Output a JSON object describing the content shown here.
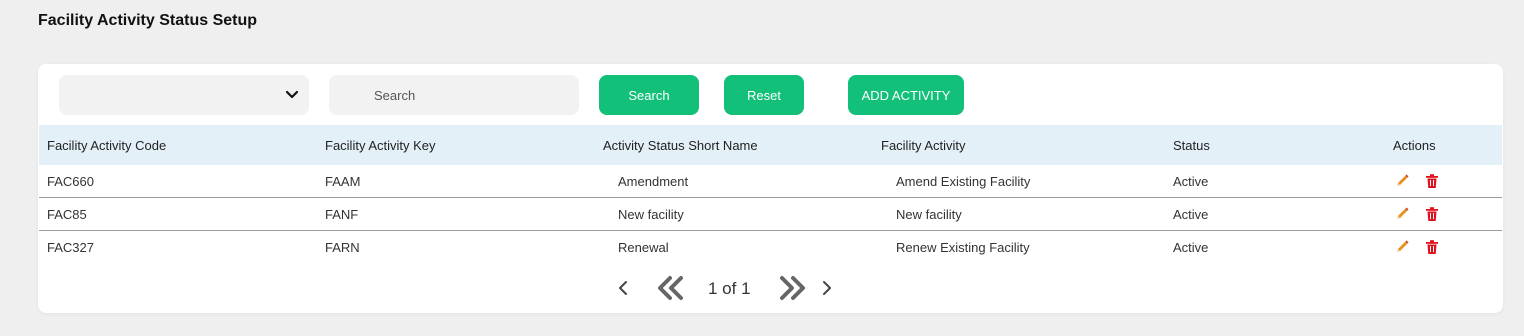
{
  "page": {
    "title": "Facility Activity Status Setup"
  },
  "filters": {
    "select_value": "",
    "search_placeholder": "Search",
    "search_button": "Search",
    "reset_button": "Reset",
    "add_button": "ADD ACTIVITY"
  },
  "table": {
    "headers": [
      "Facility Activity Code",
      "Facility Activity Key",
      "Activity Status Short Name",
      "Facility Activity",
      "Status",
      "Actions"
    ],
    "rows": [
      [
        "FAC660",
        "FAAM",
        "Amendment",
        "Amend Existing Facility",
        "Active"
      ],
      [
        "FAC85",
        "FANF",
        "New facility",
        "New facility",
        "Active"
      ],
      [
        "FAC327",
        "FARN",
        "Renewal",
        "Renew Existing Facility",
        "Active"
      ]
    ]
  },
  "pagination": {
    "label": "1 of 1"
  },
  "colors": {
    "accent": "#12c07a",
    "header_bg": "#e4f0f8",
    "delete": "#e0101e",
    "edit": "#e8901a"
  },
  "icons": [
    "chevron-down-icon",
    "edit-icon",
    "delete-icon",
    "prev-page-icon",
    "first-page-icon",
    "last-page-icon",
    "next-page-icon"
  ]
}
